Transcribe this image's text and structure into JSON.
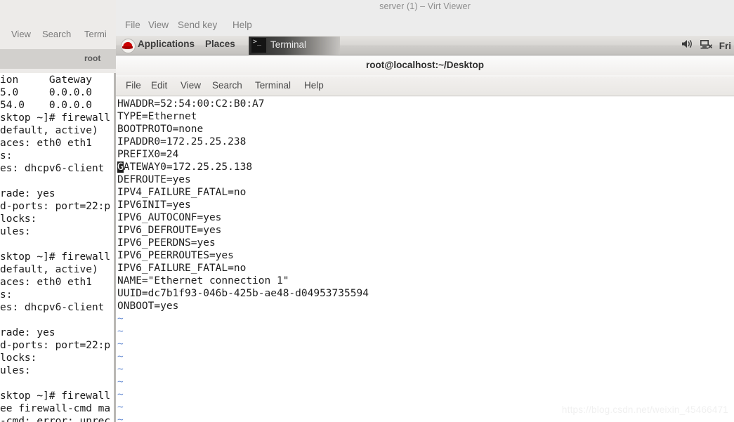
{
  "background_window": {
    "name": "gnome-terminal-background",
    "menu": [
      "View",
      "Search",
      "Termi"
    ],
    "title_fragment": "root",
    "terminal_lines": [
      "ion     Gateway",
      "5.0     0.0.0.0",
      "54.0    0.0.0.0",
      "sktop ~]# firewall",
      "default, active)",
      "aces: eth0 eth1",
      "s:",
      "es: dhcpv6-client",
      "",
      "rade: yes",
      "d-ports: port=22:p",
      "locks:",
      "ules:",
      "",
      "sktop ~]# firewall",
      "default, active)",
      "aces: eth0 eth1",
      "s:",
      "es: dhcpv6-client",
      "",
      "rade: yes",
      "d-ports: port=22:p",
      "locks:",
      "ules:",
      "",
      "sktop ~]# firewall",
      "ee firewall-cmd ma",
      "-cmd: error: unrec"
    ]
  },
  "virt_viewer": {
    "title": "server (1) – Virt Viewer",
    "menu": [
      "File",
      "View",
      "Send key",
      "Help"
    ]
  },
  "gnome_panel": {
    "logo_icon": "redhat-logo-icon",
    "applications_label": "Applications",
    "places_label": "Places",
    "task_button": {
      "icon": "terminal-icon",
      "icon_glyph": ">_",
      "label": "Terminal"
    },
    "tray": {
      "volume_icon": "volume-icon",
      "network_icon": "network-disconnected-icon",
      "clock": "Fri"
    }
  },
  "gnome_terminal": {
    "title": "root@localhost:~/Desktop",
    "menu": [
      "File",
      "Edit",
      "View",
      "Search",
      "Terminal",
      "Help"
    ],
    "editor_lines": [
      "HWADDR=52:54:00:C2:B0:A7",
      "TYPE=Ethernet",
      "BOOTPROTO=none",
      "IPADDR0=172.25.25.238",
      "PREFIX0=24",
      "GATEWAY0=172.25.25.138",
      "DEFROUTE=yes",
      "IPV4_FAILURE_FATAL=no",
      "IPV6INIT=yes",
      "IPV6_AUTOCONF=yes",
      "IPV6_DEFROUTE=yes",
      "IPV6_PEERDNS=yes",
      "IPV6_PEERROUTES=yes",
      "IPV6_FAILURE_FATAL=no",
      "NAME=\"Ethernet connection 1\"",
      "UUID=dc7b1f93-046b-425b-ae48-d04953735594",
      "ONBOOT=yes"
    ],
    "cursor": {
      "line_index": 5,
      "column": 0,
      "char": "G"
    },
    "empty_markers": [
      "~",
      "~",
      "~",
      "~",
      "~",
      "~",
      "~",
      "~",
      "~"
    ]
  },
  "watermark": "https://blog.csdn.net/weixin_45466471",
  "colors": {
    "redhat_red": "#cc0000",
    "tilde_blue": "#6b8fd4",
    "terminal_bg": "#ffffff",
    "terminal_fg": "#1f1f1f",
    "panel_bg": "#d9d7d4"
  }
}
